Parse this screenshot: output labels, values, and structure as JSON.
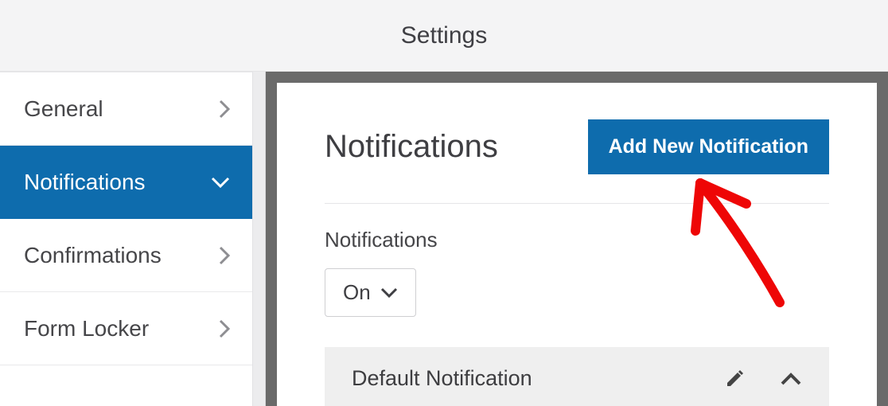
{
  "header": {
    "title": "Settings"
  },
  "sidebar": {
    "items": [
      {
        "label": "General"
      },
      {
        "label": "Notifications"
      },
      {
        "label": "Confirmations"
      },
      {
        "label": "Form Locker"
      }
    ]
  },
  "main": {
    "title": "Notifications",
    "add_button": "Add New Notification",
    "toggle_label": "Notifications",
    "toggle_value": "On",
    "default_item": "Default Notification"
  },
  "colors": {
    "accent": "#0e6cad",
    "annotation": "#ee0606"
  }
}
